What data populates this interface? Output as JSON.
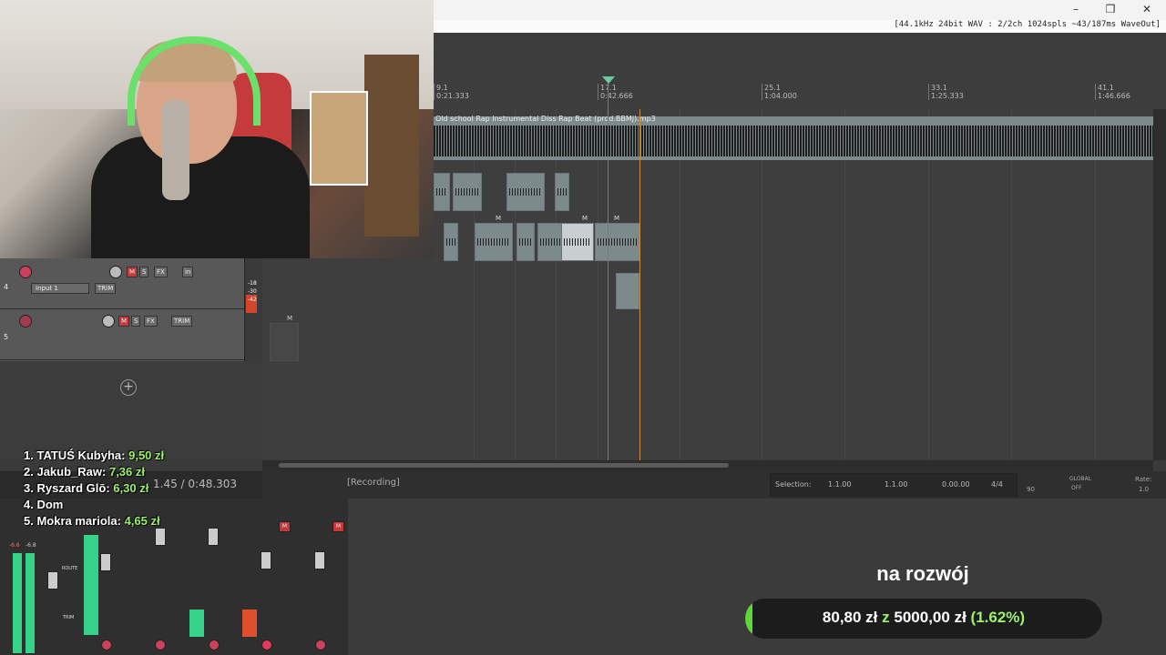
{
  "window": {
    "info_text": "[44.1kHz 24bit WAV : 2/2ch 1024spls ~43/187ms WaveOut]",
    "minimize_icon": "minimize-icon",
    "restore_icon": "restore-icon",
    "close_icon": "close-icon"
  },
  "ruler": {
    "marks": [
      {
        "bar": "9.1",
        "time": "0:21.333"
      },
      {
        "bar": "17.1",
        "time": "0:42.666"
      },
      {
        "bar": "25.1",
        "time": "1:04.000"
      },
      {
        "bar": "33.1",
        "time": "1:25.333"
      },
      {
        "bar": "41.1",
        "time": "1:46.666"
      }
    ]
  },
  "items": {
    "beat_label": "Old school Rap Instrumental  Diss Rap Beat (prod.BBMJ).mp3",
    "mute_badge": "M"
  },
  "tracks": [
    {
      "number": "4",
      "input": "Input 1",
      "trim": "TRIM",
      "in_label": "in",
      "mute": "M",
      "solo": "S",
      "fx": "FX"
    },
    {
      "number": "5",
      "trim": "TRIM",
      "mute": "M",
      "solo": "S",
      "fx": "FX"
    }
  ],
  "meter_labels": [
    "-18",
    "-30",
    "-42"
  ],
  "transport": {
    "time": "1.45 / 0:48.303",
    "status": "[Recording]",
    "selection_label": "Selection:",
    "selection_start": "1.1.00",
    "selection_end": "1.1.00",
    "selection_length": "0.00.00",
    "time_sig": "4/4",
    "bpm": "90",
    "global_label": "GLOBAL",
    "global_state": "OFF",
    "rate_label": "Rate:",
    "rate_value": "1.0"
  },
  "mixer": {
    "route_label": "ROUTE",
    "trim_label": "TRIM",
    "master_peak": "-6.6",
    "master_peak2": "-6.8"
  },
  "donors": [
    {
      "rank": "1.",
      "name": "TATUŚ Kubyha:",
      "amount": "9,50 zł"
    },
    {
      "rank": "2.",
      "name": "Jakub_Raw:",
      "amount": "7,36 zł"
    },
    {
      "rank": "3.",
      "name": "Ryszard Glō:",
      "amount": "6,30 zł"
    },
    {
      "rank": "4.",
      "name": "Dom",
      "amount": ""
    },
    {
      "rank": "5.",
      "name": "Mokra mariola:",
      "amount": "4,65 zł"
    }
  ],
  "goal": {
    "title": "na rozwój",
    "current": "80,80 zł",
    "separator": "z",
    "target": "5000,00 zł",
    "percent_text": "(1.62%)",
    "progress_fraction": 0.0162
  }
}
